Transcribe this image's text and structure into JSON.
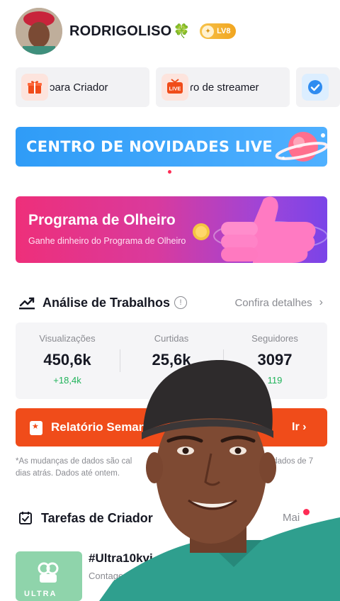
{
  "profile": {
    "username": "RODRIGOLISO",
    "emoji": "🍀",
    "level": "LV8"
  },
  "shortcuts": [
    {
      "label": "ɔara Criador",
      "icon": "gift-icon"
    },
    {
      "label": "ɾo de streamer",
      "icon": "live-icon"
    },
    {
      "label": "",
      "icon": "check-badge-icon"
    }
  ],
  "banners": {
    "live": "CENTRO DE NOVIDADES LIVE",
    "olheiro_title": "Programa de Olheiro",
    "olheiro_subtitle": "Ganhe dinheiro do Programa de Olheiro"
  },
  "analysis": {
    "title": "Análise de Trabalhos",
    "details_link": "Confira detalhes",
    "stats": [
      {
        "label": "Visualizações",
        "value": "450,6k",
        "delta": "+18,4k"
      },
      {
        "label": "Curtidas",
        "value": "25,6k",
        "delta": ""
      },
      {
        "label": "Seguidores",
        "value": "3097",
        "delta": "119"
      }
    ]
  },
  "report_button": {
    "label": "Relatório Seman",
    "action": "Ir"
  },
  "note": {
    "line_start": "*As mudanças de dados são cal",
    "line_end": "s dados de 7",
    "line2": "dias atrás. Dados até ontem."
  },
  "tasks": {
    "title": "Tarefas de Criador",
    "more": "Mai",
    "item_title": "#Ultra10kvi",
    "item_subtitle": "Contagem",
    "thumb_text": "ULTRA"
  },
  "colors": {
    "accent_red": "#fe2c55",
    "report_orange": "#f04c1a",
    "live_blue": "#2f9cf7",
    "positive_green": "#20b35a"
  }
}
